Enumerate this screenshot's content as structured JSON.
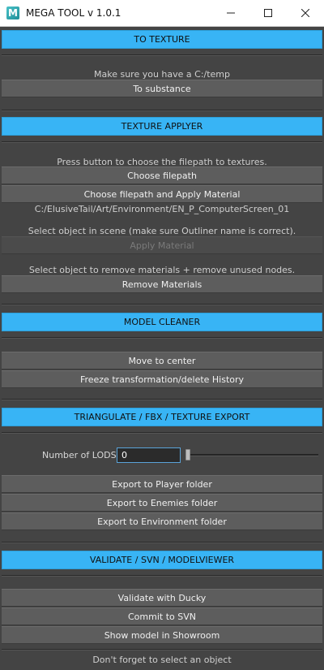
{
  "window": {
    "title": "MEGA TOOL v 1.0.1",
    "app_icon_letter": "M",
    "minimize_icon": "minimize-icon",
    "maximize_icon": "maximize-icon",
    "close_icon": "close-icon"
  },
  "colors": {
    "header_bg": "#38b4f5",
    "panel_bg": "#444444",
    "button_bg": "#5d5d5d"
  },
  "sections": {
    "to_texture": {
      "header": "TO TEXTURE",
      "note": "Make sure you have a C:/temp",
      "button": "To substance"
    },
    "texture_applyer": {
      "header": "TEXTURE APPLYER",
      "note1": "Press button to choose the filepath to textures.",
      "choose_filepath": "Choose filepath",
      "choose_apply": "Choose filepath and Apply Material",
      "path": "C:/ElusiveTail/Art/Environment/EN_P_ComputerScreen_01",
      "note2": "Select object in scene (make sure Outliner name is correct).",
      "apply_material": "Apply Material",
      "note3": "Select object to remove materials + remove unused nodes.",
      "remove_materials": "Remove Materials"
    },
    "model_cleaner": {
      "header": "MODEL CLEANER",
      "move_center": "Move to center",
      "freeze": "Freeze transformation/delete History"
    },
    "export": {
      "header": "TRIANGULATE / FBX / TEXTURE EXPORT",
      "lods_label": "Number of LODS",
      "lods_value": "0",
      "export_player": "Export to Player folder",
      "export_enemies": "Export to Enemies folder",
      "export_environment": "Export to Environment folder"
    },
    "validate": {
      "header": "VALIDATE / SVN / MODELVIEWER",
      "validate_ducky": "Validate with Ducky",
      "commit_svn": "Commit to SVN",
      "show_showroom": "Show model in Showroom",
      "footer_note": "Don't forget to select an object"
    }
  }
}
